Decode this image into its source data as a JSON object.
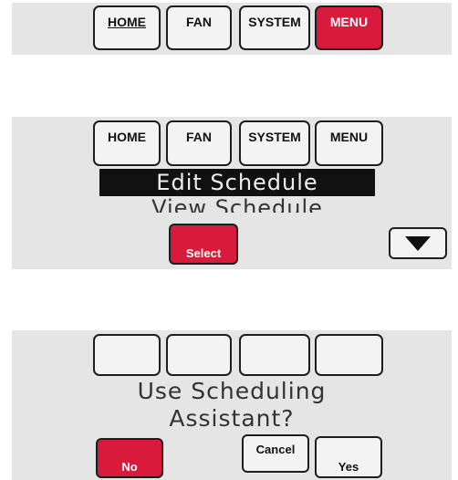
{
  "screen1": {
    "tabs": [
      {
        "label": "HOME"
      },
      {
        "label": "FAN"
      },
      {
        "label": "SYSTEM"
      },
      {
        "label": "MENU"
      }
    ]
  },
  "screen2": {
    "tabs": [
      {
        "label": "HOME"
      },
      {
        "label": "FAN"
      },
      {
        "label": "SYSTEM"
      },
      {
        "label": "MENU"
      }
    ],
    "menu_selected": "Edit Schedule",
    "menu_next": "View Schedule",
    "select_label": "Select",
    "scroll_icon": "triangle-down-icon"
  },
  "screen3": {
    "prompt_line1": "Use Scheduling",
    "prompt_line2": "Assistant?",
    "no_label": "No",
    "cancel_label": "Cancel",
    "yes_label": "Yes"
  },
  "colors": {
    "accent_red": "#d81b3c",
    "panel_bg": "#e5e5e5",
    "highlight_bg": "#111111"
  }
}
